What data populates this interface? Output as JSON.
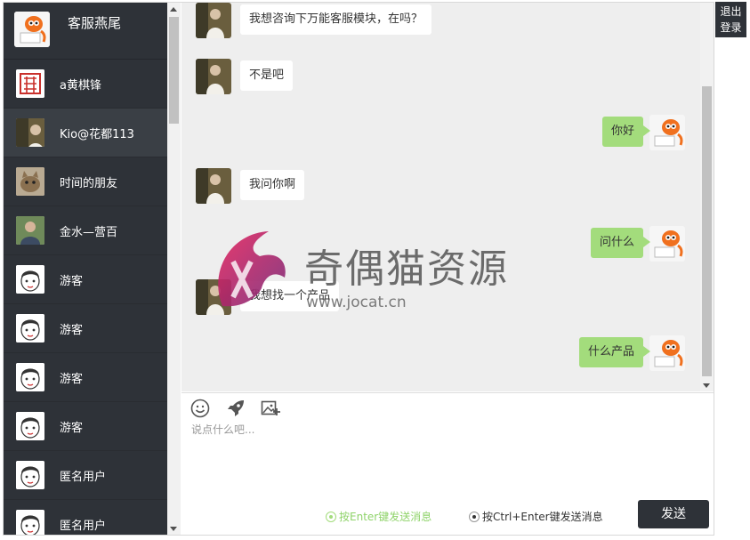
{
  "header": {
    "name": "客服燕尾"
  },
  "contacts": [
    {
      "label": "a黄棋锋",
      "avatar": "stamp-avatar-icon",
      "active": false
    },
    {
      "label": "Kio@花都113",
      "avatar": "person-photo-avatar-icon",
      "active": true
    },
    {
      "label": "时间的朋友",
      "avatar": "cat-photo-avatar-icon",
      "active": false
    },
    {
      "label": "金水—营百",
      "avatar": "man-photo-avatar-icon",
      "active": false
    },
    {
      "label": "游客",
      "avatar": "cartoon-boy-avatar-icon",
      "active": false
    },
    {
      "label": "游客",
      "avatar": "cartoon-boy-avatar-icon",
      "active": false
    },
    {
      "label": "游客",
      "avatar": "cartoon-boy-avatar-icon",
      "active": false
    },
    {
      "label": "游客",
      "avatar": "cartoon-boy-avatar-icon",
      "active": false
    },
    {
      "label": "匿名用户",
      "avatar": "cartoon-boy-avatar-icon",
      "active": false
    },
    {
      "label": "匿名用户",
      "avatar": "cartoon-boy-avatar-icon",
      "active": false
    }
  ],
  "messages": [
    {
      "side": "left",
      "text": "我想咨询下万能客服模块，在吗？"
    },
    {
      "side": "left",
      "text": "不是吧"
    },
    {
      "side": "right",
      "text": "你好"
    },
    {
      "side": "left",
      "text": "我问你啊"
    },
    {
      "side": "right",
      "text": "问什么"
    },
    {
      "side": "left",
      "text": "我想找一个产品"
    },
    {
      "side": "right",
      "text": "什么产品"
    }
  ],
  "watermark": {
    "title": "奇偶猫资源",
    "url": "www.jocat.cn"
  },
  "composer": {
    "placeholder": "说点什么吧...",
    "option_enter": "按Enter键发送消息",
    "option_ctrl": "按Ctrl+Enter键发送消息",
    "send_label": "发送"
  },
  "logout": {
    "line1": "退出",
    "line2": "登录"
  },
  "colors": {
    "sidebar": "#2e3238",
    "bubble_right": "#a3dc7c",
    "chat_bg": "#eeeeee"
  }
}
